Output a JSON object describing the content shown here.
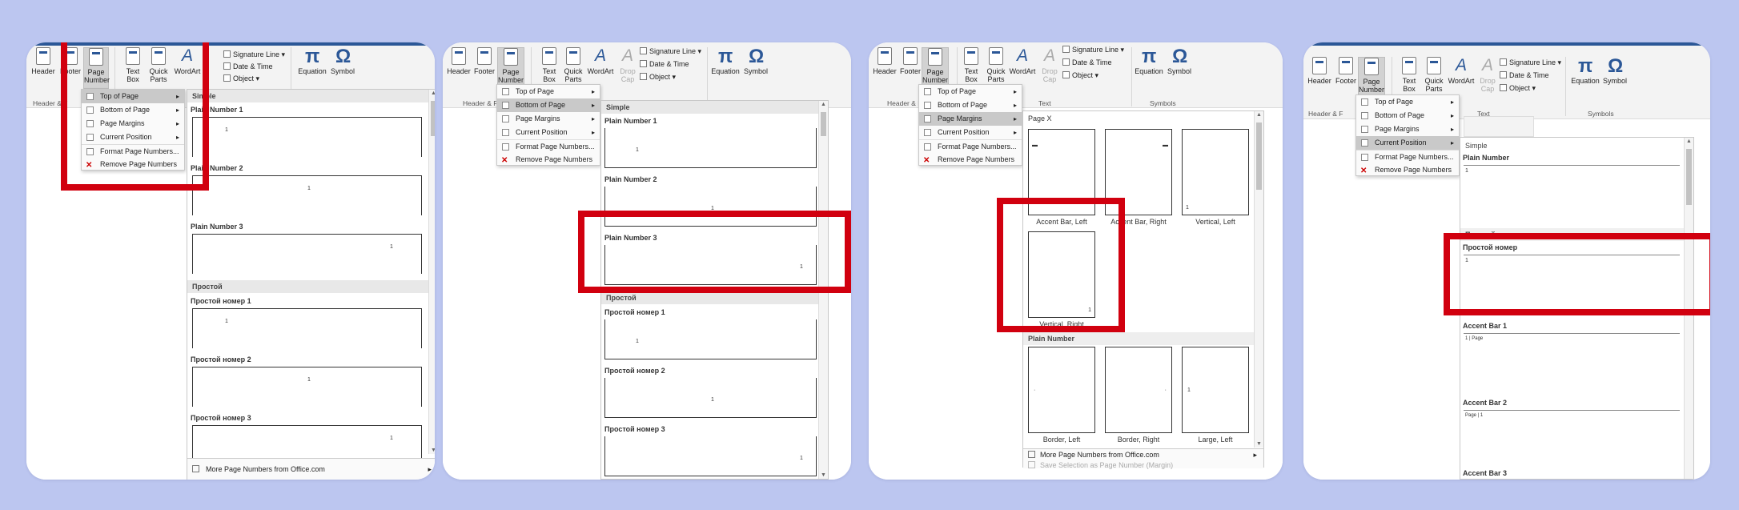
{
  "ribbon": {
    "header": "Header",
    "footer": "Footer",
    "page_number": [
      "Page",
      "Number"
    ],
    "text_box": [
      "Text",
      "Box"
    ],
    "quick_parts": [
      "Quick",
      "Parts"
    ],
    "wordart": "WordArt",
    "drop_cap": [
      "Drop",
      "Cap"
    ],
    "signature_line": "Signature Line",
    "date_time": "Date & Time",
    "object": "Object",
    "equation": "Equation",
    "symbol": "Symbol",
    "group_header_footer": "Header & Footer",
    "group_header_partial": "Header & F",
    "group_text": "Text",
    "group_symbols": "Symbols"
  },
  "menu": {
    "top_of_page": "Top of Page",
    "bottom_of_page": "Bottom of Page",
    "page_margins": "Page Margins",
    "current_position": "Current Position",
    "format_page_numbers": "Format Page Numbers...",
    "remove_page_numbers": "Remove Page Numbers"
  },
  "gallery": {
    "simple": "Simple",
    "plain_number_1": "Plain Number 1",
    "plain_number_2": "Plain Number 2",
    "plain_number_3": "Plain Number 3",
    "plain_number": "Plain Number",
    "ru_section": "Простой",
    "ru_item_1": "Простой номер 1",
    "ru_item_2": "Простой номер 2",
    "ru_item_3": "Простой номер 3",
    "ru_item": "Простой номер",
    "page_x": "Page X",
    "accent_bar_left": "Accent Bar, Left",
    "accent_bar_right": "Accent Bar, Right",
    "vertical_left": "Vertical, Left",
    "vertical_right": "Vertical, Right",
    "border_left": "Border, Left",
    "border_right": "Border, Right",
    "large_left": "Large, Left",
    "accent_bar_1": "Accent Bar 1",
    "accent_bar_2": "Accent Bar 2",
    "accent_bar_3": "Accent Bar 3",
    "more_from_office": "More Page Numbers from Office.com",
    "save_selection": "Save Selection as Page Number (Margin)"
  },
  "colors": {
    "background": "#bcc6f0",
    "highlight_box": "#d1000f",
    "word_blue": "#2b5797"
  }
}
